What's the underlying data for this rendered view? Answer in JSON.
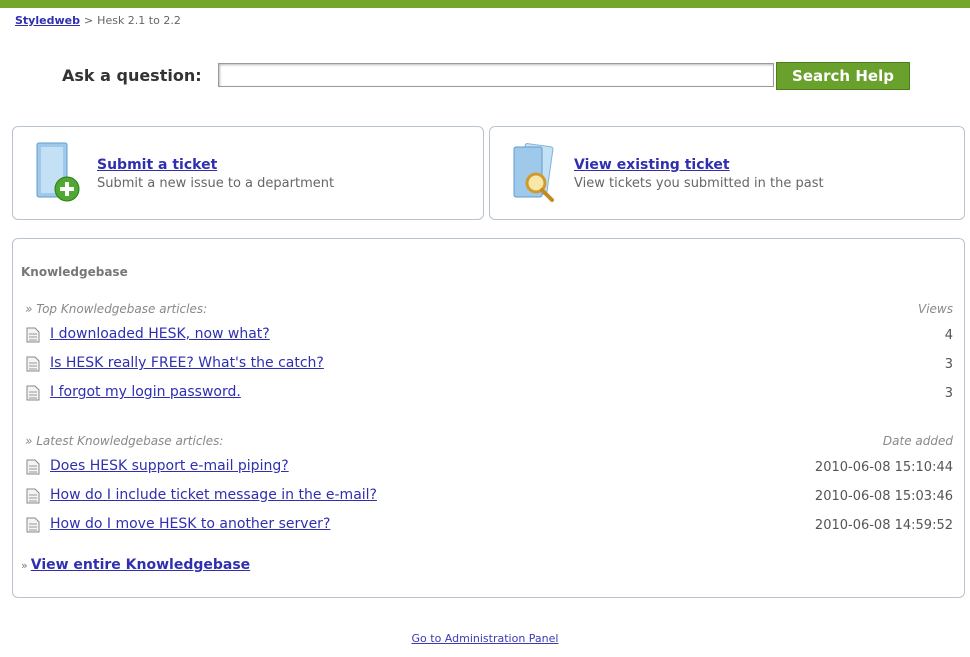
{
  "breadcrumb": {
    "home": "Styledweb",
    "separator": ">",
    "current": "Hesk 2.1 to 2.2"
  },
  "search": {
    "label": "Ask a question:",
    "value": "",
    "button": "Search Help"
  },
  "actions": {
    "submit": {
      "title": "Submit a ticket",
      "description": "Submit a new issue to a department",
      "icon": "new-ticket-icon"
    },
    "view": {
      "title": "View existing ticket",
      "description": "View tickets you submitted in the past",
      "icon": "view-ticket-icon"
    }
  },
  "kb": {
    "title": "Knowledgebase",
    "top": {
      "heading": "» Top Knowledgebase articles:",
      "col": "Views",
      "items": [
        {
          "title": "I downloaded HESK, now what?",
          "value": "4"
        },
        {
          "title": "Is HESK really FREE? What's the catch?",
          "value": "3"
        },
        {
          "title": "I forgot my login password.",
          "value": "3"
        }
      ]
    },
    "latest": {
      "heading": "» Latest Knowledgebase articles:",
      "col": "Date added",
      "items": [
        {
          "title": "Does HESK support e-mail piping?",
          "value": "2010-06-08 15:10:44"
        },
        {
          "title": "How do I include ticket message in the e-mail?",
          "value": "2010-06-08 15:03:46"
        },
        {
          "title": "How do I move HESK to another server?",
          "value": "2010-06-08 14:59:52"
        }
      ]
    },
    "view_all_arrow": "»",
    "view_all": "View entire Knowledgebase"
  },
  "admin_link": "Go to Administration Panel",
  "colors": {
    "accent": "#74a62a",
    "button": "#6aa02c",
    "link": "#2f2fb0",
    "border": "#b9c3cf"
  }
}
